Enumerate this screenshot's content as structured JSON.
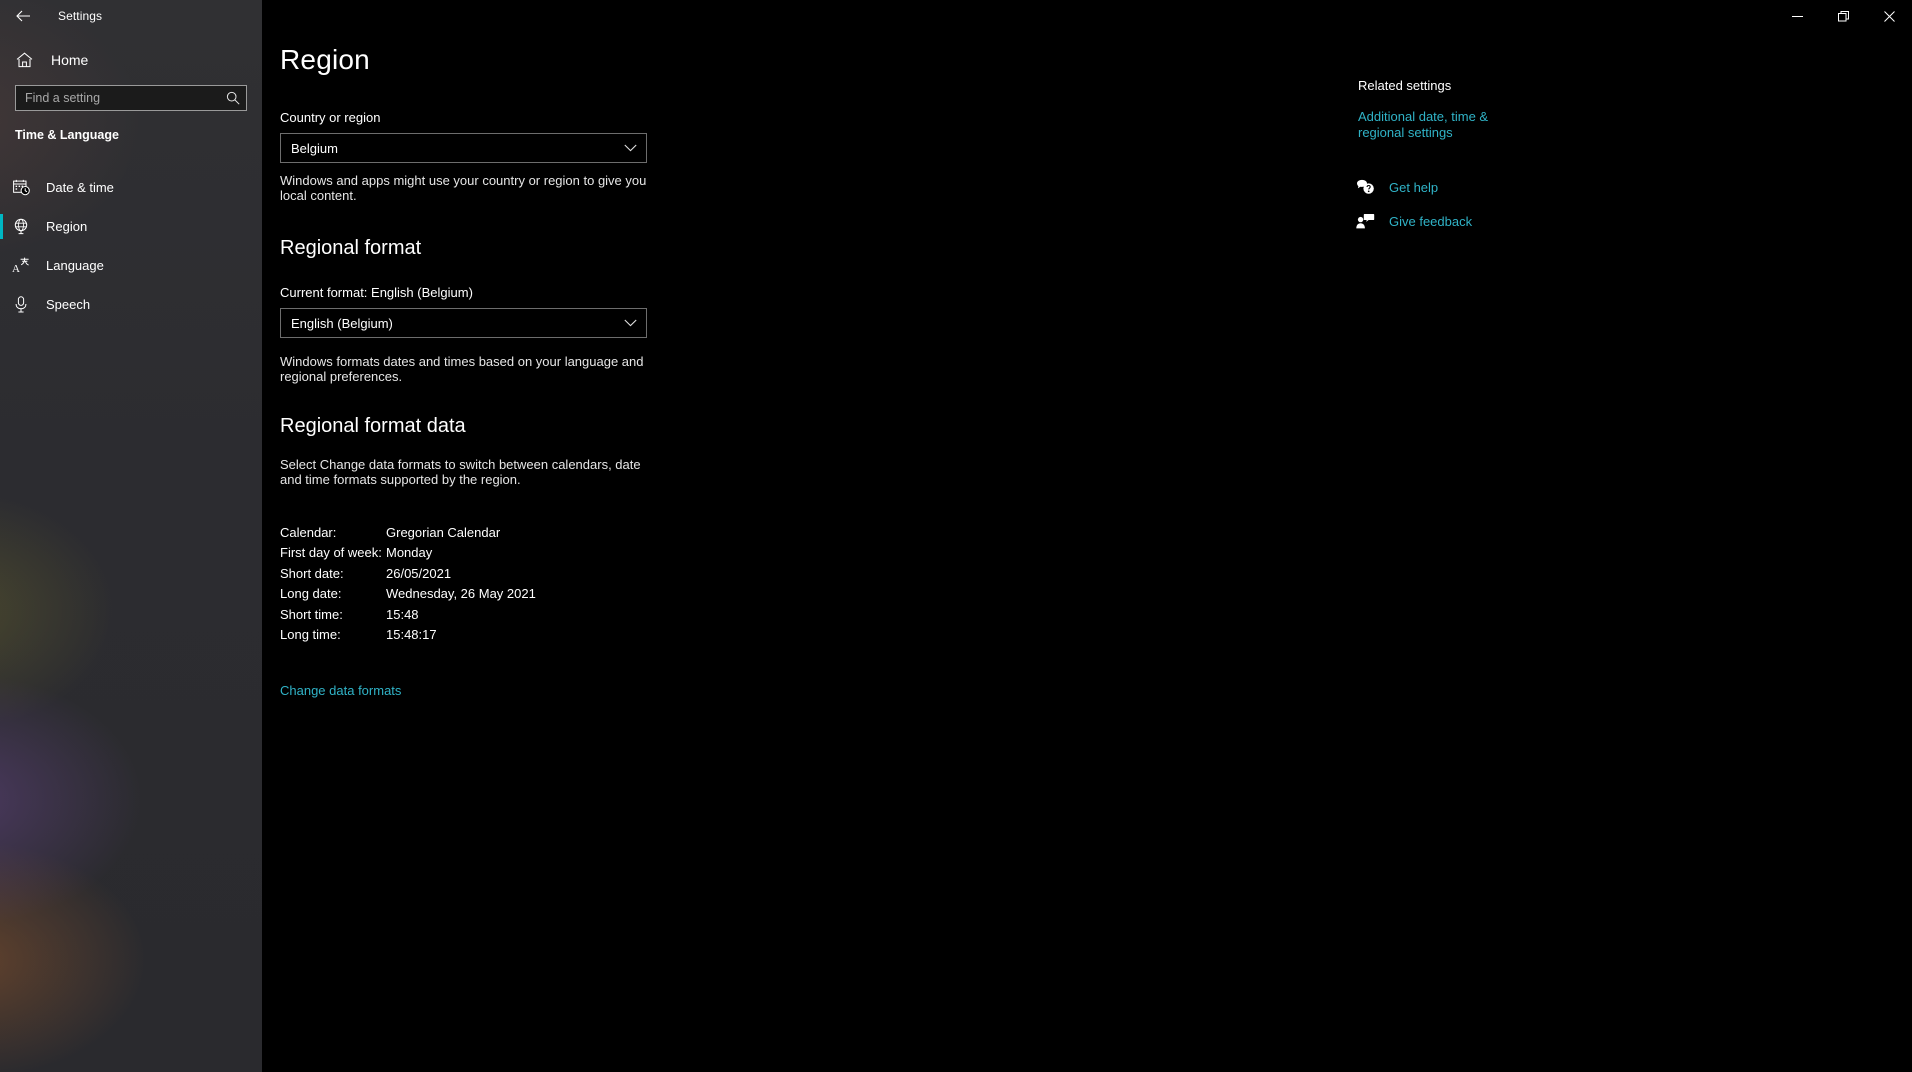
{
  "window": {
    "title": "Settings",
    "back_label": "Back",
    "minimize_label": "Minimize",
    "restore_label": "Restore",
    "close_label": "Close"
  },
  "sidebar": {
    "home_label": "Home",
    "search": {
      "placeholder": "Find a setting",
      "value": ""
    },
    "category": "Time & Language",
    "items": [
      {
        "label": "Date & time",
        "icon": "calendar-clock-icon",
        "active": false
      },
      {
        "label": "Region",
        "icon": "globe-icon",
        "active": true
      },
      {
        "label": "Language",
        "icon": "language-icon",
        "active": false
      },
      {
        "label": "Speech",
        "icon": "microphone-icon",
        "active": false
      }
    ],
    "accent_color": "#00b7c3"
  },
  "main": {
    "page_title": "Region",
    "country": {
      "label": "Country or region",
      "value": "Belgium",
      "description": "Windows and apps might use your country or region to give you local content."
    },
    "regional_format": {
      "heading": "Regional format",
      "current_label": "Current format: English (Belgium)",
      "value": "English (Belgium)",
      "description": "Windows formats dates and times based on your language and regional preferences."
    },
    "regional_format_data": {
      "heading": "Regional format data",
      "description": "Select Change data formats to switch between calendars, date and time formats supported by the region.",
      "rows": [
        {
          "key": "Calendar:",
          "value": "Gregorian Calendar"
        },
        {
          "key": "First day of week:",
          "value": "Monday"
        },
        {
          "key": "Short date:",
          "value": "26/05/2021"
        },
        {
          "key": "Long date:",
          "value": "Wednesday, 26 May 2021"
        },
        {
          "key": "Short time:",
          "value": "15:48"
        },
        {
          "key": "Long time:",
          "value": "15:48:17"
        }
      ],
      "change_link": "Change data formats"
    }
  },
  "related": {
    "heading": "Related settings",
    "link": "Additional date, time & regional settings",
    "help": [
      {
        "label": "Get help",
        "icon": "help-bubble-icon"
      },
      {
        "label": "Give feedback",
        "icon": "feedback-person-icon"
      }
    ],
    "link_color": "#30b3c7"
  }
}
